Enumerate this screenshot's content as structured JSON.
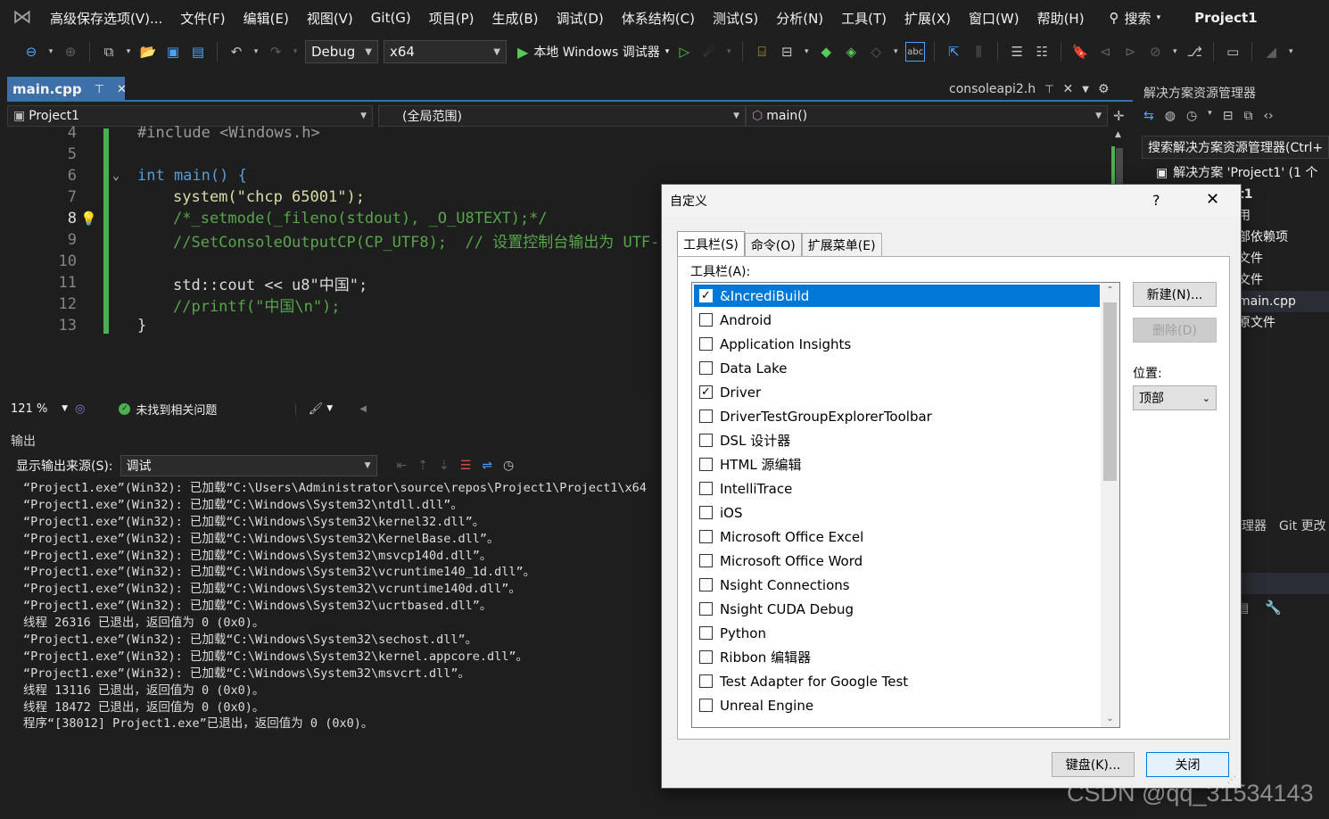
{
  "menu": {
    "items": [
      "高级保存选项(V)...",
      "文件(F)",
      "编辑(E)",
      "视图(V)",
      "Git(G)",
      "项目(P)",
      "生成(B)",
      "调试(D)",
      "体系结构(C)",
      "测试(S)",
      "分析(N)",
      "工具(T)",
      "扩展(X)",
      "窗口(W)",
      "帮助(H)"
    ],
    "search_label": "搜索",
    "project_name": "Project1"
  },
  "toolbar": {
    "config": "Debug",
    "platform": "x64",
    "run_label": "本地 Windows 调试器"
  },
  "editor": {
    "active_tab": "main.cpp",
    "other_tab": "consoleapi2.h",
    "nav_project": "Project1",
    "nav_scope": "(全局范围)",
    "nav_member": "main()",
    "lines": [
      {
        "n": "4",
        "text": "#include <Windows.h>"
      },
      {
        "n": "5",
        "text": ""
      },
      {
        "n": "6",
        "text": "int main() {"
      },
      {
        "n": "7",
        "text": "system(\"chcp 65001\");"
      },
      {
        "n": "8",
        "text": "/*_setmode(_fileno(stdout), _O_U8TEXT);*/"
      },
      {
        "n": "9",
        "text": "//SetConsoleOutputCP(CP_UTF8);  // 设置控制台输出为 UTF-"
      },
      {
        "n": "10",
        "text": ""
      },
      {
        "n": "11",
        "text": "std::cout << u8\"中国\";"
      },
      {
        "n": "12",
        "text": "//printf(\"中国\\n\");"
      },
      {
        "n": "13",
        "text": "}"
      }
    ],
    "zoom": "121 %",
    "issues": "未找到相关问题"
  },
  "output": {
    "title": "输出",
    "source_label": "显示输出来源(S):",
    "source_value": "调试",
    "lines": [
      "“Project1.exe”(Win32): 已加载“C:\\Users\\Administrator\\source\\repos\\Project1\\Project1\\x64",
      "“Project1.exe”(Win32): 已加载“C:\\Windows\\System32\\ntdll.dll”。",
      "“Project1.exe”(Win32): 已加载“C:\\Windows\\System32\\kernel32.dll”。",
      "“Project1.exe”(Win32): 已加载“C:\\Windows\\System32\\KernelBase.dll”。",
      "“Project1.exe”(Win32): 已加载“C:\\Windows\\System32\\msvcp140d.dll”。",
      "“Project1.exe”(Win32): 已加载“C:\\Windows\\System32\\vcruntime140_1d.dll”。",
      "“Project1.exe”(Win32): 已加载“C:\\Windows\\System32\\vcruntime140d.dll”。",
      "“Project1.exe”(Win32): 已加载“C:\\Windows\\System32\\ucrtbased.dll”。",
      "线程 26316 已退出，返回值为 0 (0x0)。",
      "“Project1.exe”(Win32): 已加载“C:\\Windows\\System32\\sechost.dll”。",
      "“Project1.exe”(Win32): 已加载“C:\\Windows\\System32\\kernel.appcore.dll”。",
      "“Project1.exe”(Win32): 已加载“C:\\Windows\\System32\\msvcrt.dll”。",
      "线程 13116 已退出，返回值为 0 (0x0)。",
      "线程 18472 已退出，返回值为 0 (0x0)。",
      "程序“[38012] Project1.exe”已退出，返回值为 0 (0x0)。"
    ]
  },
  "solution": {
    "title": "解决方案资源管理器",
    "search_text": "搜索解决方案资源管理器(Ctrl+",
    "tree": [
      "解决方案 'Project1' (1 个",
      "t1",
      "用",
      "部依赖项",
      "文件",
      "文件",
      "main.cpp",
      "原文件"
    ],
    "bottom_tabs": [
      "理器",
      "Git 更改"
    ]
  },
  "dialog": {
    "title": "自定义",
    "help": "?",
    "tabs": [
      "工具栏(S)",
      "命令(O)",
      "扩展菜单(E)"
    ],
    "list_label": "工具栏(A):",
    "items": [
      {
        "label": "&IncrediBuild",
        "checked": true,
        "selected": true
      },
      {
        "label": "Android",
        "checked": false
      },
      {
        "label": "Application Insights",
        "checked": false
      },
      {
        "label": "Data Lake",
        "checked": false
      },
      {
        "label": "Driver",
        "checked": true
      },
      {
        "label": "DriverTestGroupExplorerToolbar",
        "checked": false
      },
      {
        "label": "DSL 设计器",
        "checked": false
      },
      {
        "label": "HTML 源编辑",
        "checked": false
      },
      {
        "label": "IntelliTrace",
        "checked": false
      },
      {
        "label": "iOS",
        "checked": false
      },
      {
        "label": "Microsoft Office Excel",
        "checked": false
      },
      {
        "label": "Microsoft Office Word",
        "checked": false
      },
      {
        "label": "Nsight Connections",
        "checked": false
      },
      {
        "label": "Nsight CUDA Debug",
        "checked": false
      },
      {
        "label": "Python",
        "checked": false
      },
      {
        "label": "Ribbon 编辑器",
        "checked": false
      },
      {
        "label": "Test Adapter for Google Test",
        "checked": false
      },
      {
        "label": "Unreal Engine",
        "checked": false
      }
    ],
    "new_button": "新建(N)...",
    "delete_button": "删除(D)",
    "position_label": "位置:",
    "position_value": "顶部",
    "keyboard_button": "键盘(K)...",
    "close_button": "关闭"
  },
  "watermark": "CSDN @qq_31534143"
}
